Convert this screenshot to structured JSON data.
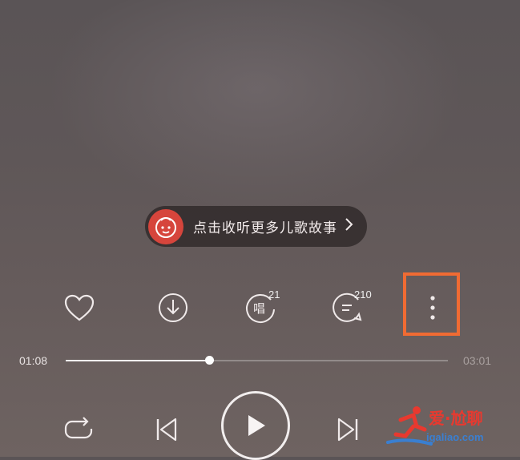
{
  "promo": {
    "text": "点击收听更多儿歌故事",
    "icon": "kid-face-icon",
    "chevron": "chevron-right-icon"
  },
  "actions": {
    "like": {
      "icon": "heart-icon"
    },
    "download": {
      "icon": "download-icon"
    },
    "sing": {
      "icon": "sing-icon",
      "char": "唱",
      "count": "21"
    },
    "comment": {
      "icon": "comment-icon",
      "count": "210"
    },
    "more": {
      "icon": "more-vertical-icon"
    }
  },
  "progress": {
    "elapsed": "01:08",
    "total": "03:01",
    "fraction": 0.375
  },
  "controls": {
    "repeat": "repeat-icon",
    "previous": "skip-previous-icon",
    "play": "play-icon",
    "next": "skip-next-icon"
  },
  "watermark": {
    "text": "爱·尬聊",
    "url": "igaliao.com",
    "logo": "runner-logo-icon"
  },
  "colors": {
    "highlight": "#f06b33",
    "promo_icon_bg": "#d6453c",
    "watermark_red": "#e8392f",
    "watermark_blue": "#3a7fd1"
  }
}
